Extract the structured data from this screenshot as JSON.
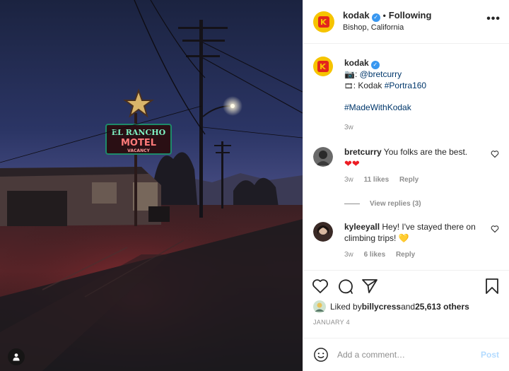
{
  "header": {
    "username": "kodak",
    "separator": "•",
    "follow_label": "Following",
    "location": "Bishop, California",
    "more_label": "•••"
  },
  "caption": {
    "username": "kodak",
    "line1_mention": "@bretcurry",
    "line2_prefix": ": Kodak ",
    "line2_tag": "#Portra160",
    "hashtag": "#MadeWithKodak",
    "time": "3w"
  },
  "comments": [
    {
      "username": "bretcurry",
      "text": " You folks are the best.",
      "emoji": "❤❤",
      "time": "3w",
      "likes": "11 likes",
      "reply_label": "Reply",
      "view_replies": "View replies (3)"
    },
    {
      "username": "kyleeyall",
      "text": " Hey! I've stayed there on climbing trips!",
      "emoji": "💛",
      "time": "3w",
      "likes": "6 likes",
      "reply_label": "Reply"
    }
  ],
  "likes": {
    "prefix": "Liked by ",
    "user": "billycress",
    "middle": " and ",
    "count": "25,613 others"
  },
  "date": "JANUARY 4",
  "add_comment": {
    "placeholder": "Add a comment…",
    "post_label": "Post"
  },
  "photo": {
    "sign_line1": "EL RANCHO",
    "sign_line2": "MOTEL",
    "sign_line3": "VACANCY"
  },
  "colors": {
    "kodak_yellow": "#f6c400",
    "kodak_red": "#e3261d",
    "verified_blue": "#3897f0",
    "link": "#00376b",
    "post_disabled": "#b3dbff"
  }
}
